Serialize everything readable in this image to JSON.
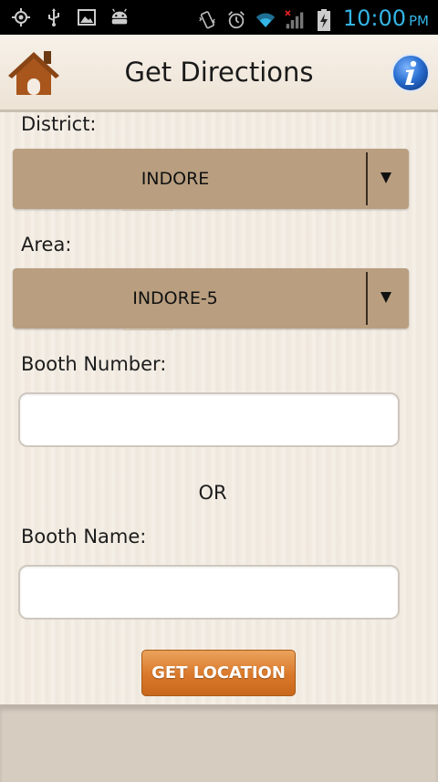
{
  "status_bar": {
    "time": "10:00",
    "ampm": "PM",
    "time_color": "#33b5e5",
    "left_icons": [
      "gps-icon",
      "usb-icon",
      "gallery-icon",
      "android-icon"
    ],
    "right_icons": [
      "vibrate-icon",
      "alarm-icon",
      "wifi-icon",
      "signal-icon",
      "battery-charging-icon"
    ]
  },
  "header": {
    "title": "Get Directions",
    "home_icon": "home-icon",
    "info_icon": "info-icon"
  },
  "form": {
    "district": {
      "label": "District:",
      "value": "INDORE"
    },
    "area": {
      "label": "Area:",
      "value": "INDORE-5"
    },
    "booth_number": {
      "label": "Booth Number:",
      "value": "",
      "placeholder": ""
    },
    "or_label": "OR",
    "booth_name": {
      "label": "Booth Name:",
      "value": "",
      "placeholder": ""
    },
    "submit_label": "GET LOCATION"
  },
  "colors": {
    "spinner_bg": "#b99f80",
    "button_orange": "#d9782a",
    "home_brown": "#a0521c",
    "info_blue": "#2a6fd1"
  }
}
